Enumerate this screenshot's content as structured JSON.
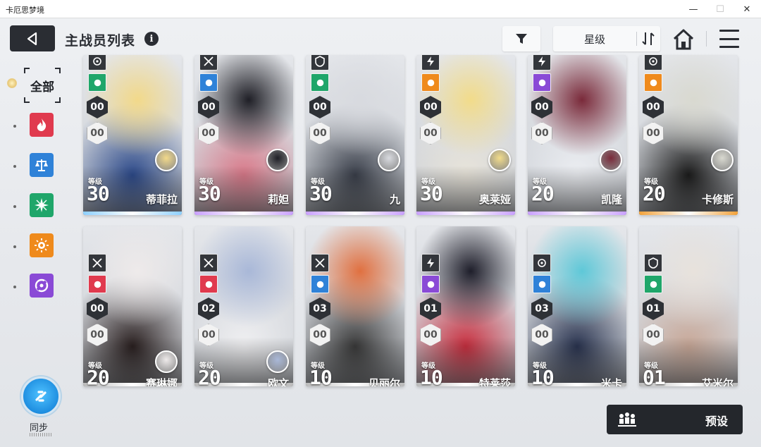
{
  "window": {
    "title": "卡厄思梦境",
    "min": "—",
    "max": "☐",
    "close": "✕"
  },
  "header": {
    "title": "主战员列表",
    "info": "i",
    "sort_label": "星级",
    "icons": [
      "back-arrow-icon",
      "info-icon",
      "filter-icon",
      "sort-icon",
      "home-icon",
      "menu-icon"
    ]
  },
  "sidebar": {
    "all_label": "全部",
    "filters": [
      {
        "name": "fire",
        "color": "#e03a4e"
      },
      {
        "name": "balance",
        "color": "#2f82d8"
      },
      {
        "name": "nature",
        "color": "#1fa66a"
      },
      {
        "name": "sun",
        "color": "#ef8a1c"
      },
      {
        "name": "void",
        "color": "#8a4ad6"
      }
    ],
    "sync_label": "同步"
  },
  "level_word": "等级",
  "cards": [
    {
      "name": "蒂菲拉",
      "level": "30",
      "top_num": "00",
      "bot_num": "00",
      "element": "#1fa66a",
      "art": [
        "#f2d98a",
        "#2d4a8a"
      ],
      "glow": "#8ed0ff"
    },
    {
      "name": "莉妲",
      "level": "30",
      "top_num": "00",
      "bot_num": "00",
      "element": "#2f82d8",
      "art": [
        "#1f1f26",
        "#d97a8a"
      ],
      "glow": "#c9a0ff"
    },
    {
      "name": "九",
      "level": "30",
      "top_num": "00",
      "bot_num": "00",
      "element": "#1fa66a",
      "art": [
        "#d8dadf",
        "#3a3f4a"
      ],
      "glow": "#c9a0ff"
    },
    {
      "name": "奥莱娅",
      "level": "30",
      "top_num": "00",
      "bot_num": "00",
      "element": "#ef8a1c",
      "art": [
        "#f2dc8a",
        "#e8e4da"
      ],
      "glow": "#c9a0ff"
    },
    {
      "name": "凯隆",
      "level": "20",
      "top_num": "00",
      "bot_num": "00",
      "element": "#8a4ad6",
      "art": [
        "#7a2a3a",
        "#eceef2"
      ],
      "glow": "#c9a0ff"
    },
    {
      "name": "卡修斯",
      "level": "20",
      "top_num": "00",
      "bot_num": "00",
      "element": "#ef8a1c",
      "art": [
        "#d9d9d0",
        "#1c1c1c"
      ],
      "glow": "#f2a23a"
    },
    {
      "name": "赛琳娜",
      "level": "20",
      "top_num": "00",
      "bot_num": "00",
      "element": "#e03a4e",
      "art": [
        "#eeeaea",
        "#2a2020"
      ],
      "glow": "#bbbbbb"
    },
    {
      "name": "欧文",
      "level": "20",
      "top_num": "02",
      "bot_num": "00",
      "element": "#e03a4e",
      "art": [
        "#a9b8d8",
        "#f0f0f2"
      ],
      "glow": "#bbbbbb"
    },
    {
      "name": "贝丽尔",
      "level": "10",
      "top_num": "03",
      "bot_num": "00",
      "element": "#2f82d8",
      "art": [
        "#e07040",
        "#3a3a3a"
      ],
      "glow": "#bbbbbb"
    },
    {
      "name": "特莱莎",
      "level": "10",
      "top_num": "01",
      "bot_num": "00",
      "element": "#8a4ad6",
      "art": [
        "#1e1e2a",
        "#c83040"
      ],
      "glow": "#bbbbbb"
    },
    {
      "name": "米卡",
      "level": "10",
      "top_num": "03",
      "bot_num": "00",
      "element": "#2f82d8",
      "art": [
        "#5ec8d8",
        "#2a3450"
      ],
      "glow": "#bbbbbb"
    },
    {
      "name": "艾米尔",
      "level": "01",
      "top_num": "01",
      "bot_num": "00",
      "element": "#1fa66a",
      "art": [
        "#e8e2dc",
        "#c8a898"
      ],
      "glow": "#bbbbbb"
    }
  ],
  "preset_label": "预设"
}
